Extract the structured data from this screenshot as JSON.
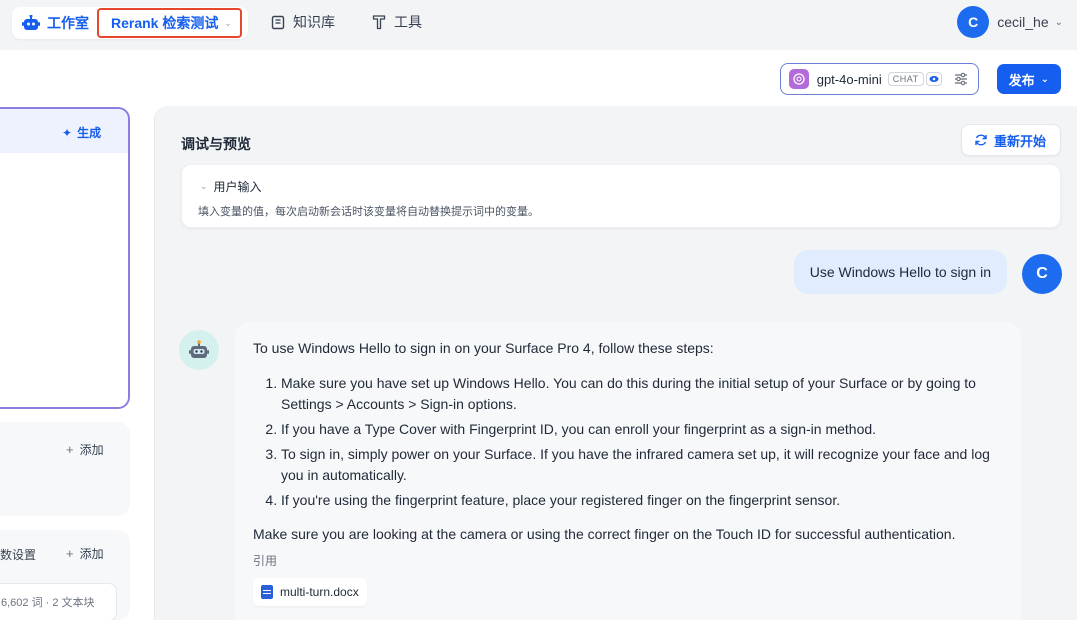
{
  "topbar": {
    "studio_label": "工作室",
    "app_name": "Rerank 检索测试",
    "nav": [
      {
        "label": "知识库",
        "icon": "book-icon"
      },
      {
        "label": "工具",
        "icon": "tool-icon"
      }
    ],
    "user": {
      "initial": "C",
      "name": "cecil_he"
    }
  },
  "toolbar": {
    "model_name": "gpt-4o-mini",
    "model_badge": "CHAT",
    "publish_label": "发布"
  },
  "config": {
    "generate_label": "生成",
    "add_label_1": "添加",
    "param_label": "数设置",
    "add_label_2": "添加",
    "file_meta": "6,602 词 · 2 文本块"
  },
  "debug": {
    "title": "调试与预览",
    "restart_label": "重新开始",
    "inputs_title": "用户输入",
    "inputs_desc": "填入变量的值，每次启动新会话时该变量将自动替换提示词中的变量。",
    "user_initial": "C",
    "user_message": "Use Windows Hello to sign in",
    "answer": {
      "intro": "To use Windows Hello to sign in on your Surface Pro 4, follow these steps:",
      "steps": [
        "Make sure you have set up Windows Hello. You can do this during the initial setup of your Surface or by going to Settings > Accounts > Sign-in options.",
        "If you have a Type Cover with Fingerprint ID, you can enroll your fingerprint as a sign-in method.",
        "To sign in, simply power on your Surface. If you have the infrared camera set up, it will recognize your face and log you in automatically.",
        "If you're using the fingerprint feature, place your registered finger on the fingerprint sensor."
      ],
      "outro": "Make sure you are looking at the camera or using the correct finger on the Touch ID for successful authentication.",
      "citation_label": "引用",
      "citation_file": "multi-turn.docx"
    }
  },
  "colors": {
    "accent": "#155eef",
    "highlight_border": "#e5472d",
    "prompt_border": "#8b7ee0",
    "user_bubble": "#e1ecff"
  }
}
